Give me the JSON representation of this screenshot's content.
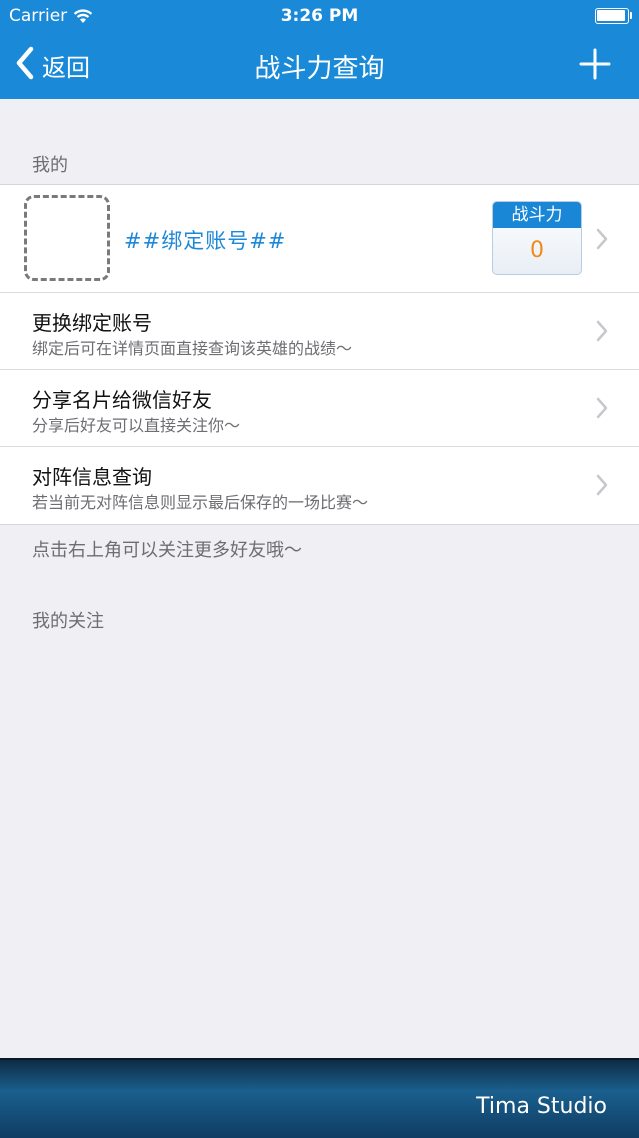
{
  "status_bar": {
    "carrier": "Carrier",
    "time": "3:26 PM"
  },
  "nav": {
    "back_label": "返回",
    "title": "战斗力查询"
  },
  "sections": {
    "mine": "我的",
    "following": "我的关注"
  },
  "profile": {
    "account_placeholder": "##绑定账号##",
    "power_label": "战斗力",
    "power_value": "0"
  },
  "menu": [
    {
      "title": "更换绑定账号",
      "subtitle": "绑定后可在详情页面直接查询该英雄的战绩～"
    },
    {
      "title": "分享名片给微信好友",
      "subtitle": "分享后好友可以直接关注你～"
    },
    {
      "title": "对阵信息查询",
      "subtitle": "若当前无对阵信息则显示最后保存的一场比赛～"
    }
  ],
  "footer_note": "点击右上角可以关注更多好友哦～",
  "banner": {
    "text": "Tima Studio"
  },
  "colors": {
    "nav_bar": "#1a8ad8",
    "accent_blue": "#1e88d8",
    "power_value": "#f08a18",
    "background": "#efeff4"
  }
}
